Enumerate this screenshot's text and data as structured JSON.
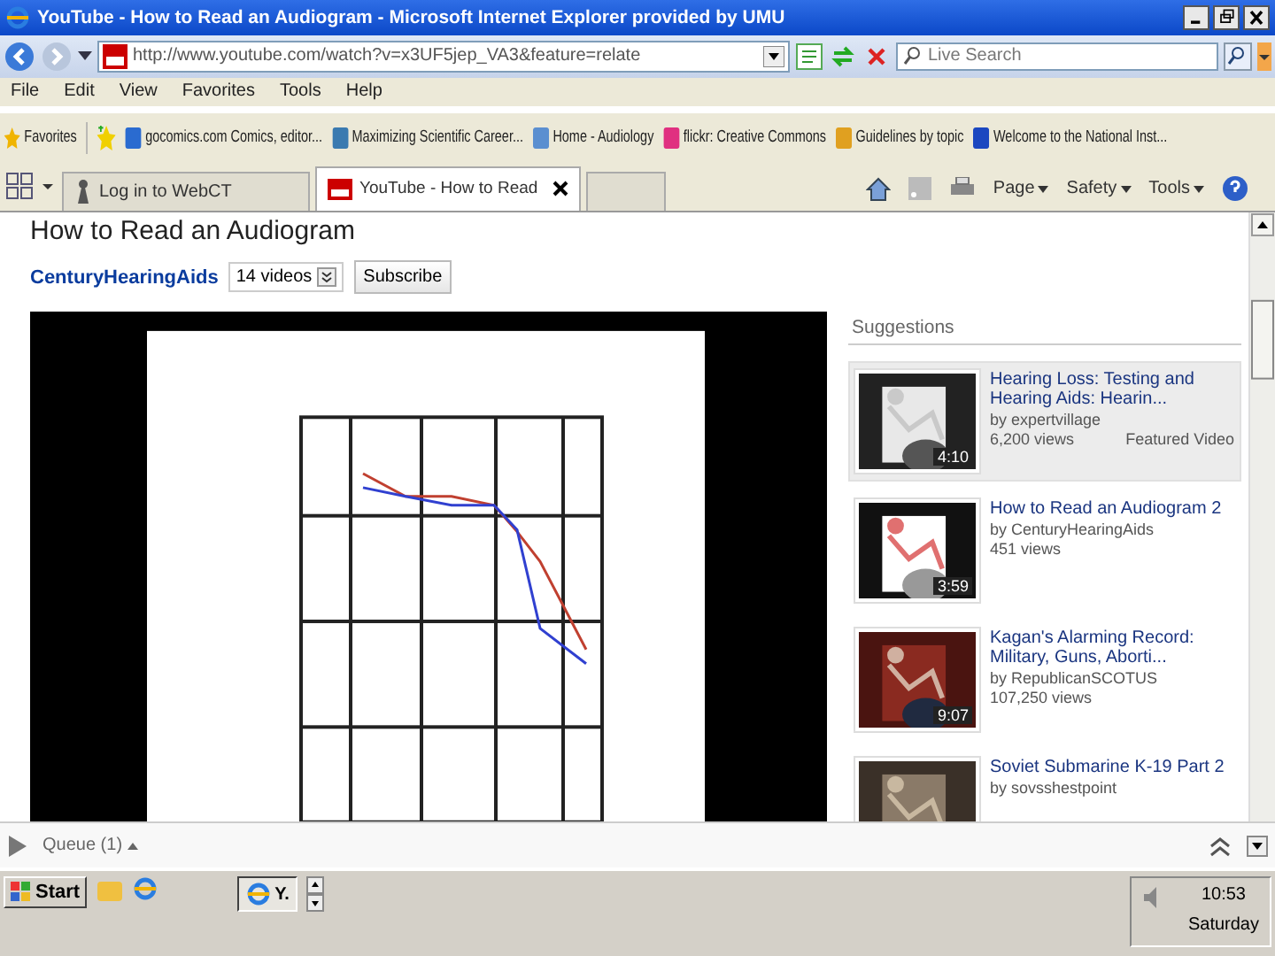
{
  "window": {
    "title": "YouTube - How to Read an Audiogram - Microsoft Internet Explorer provided by UMU"
  },
  "address_bar": {
    "url": "http://www.youtube.com/watch?v=x3UF5jep_VA3&feature=relate",
    "search_placeholder": "Live Search"
  },
  "menu": [
    "File",
    "Edit",
    "View",
    "Favorites",
    "Tools",
    "Help"
  ],
  "favorites_bar": {
    "label": "Favorites",
    "links": [
      "gocomics.com Comics, editor...",
      "Maximizing Scientific Career...",
      "Home - Audiology",
      "flickr: Creative Commons",
      "Guidelines by topic",
      "Welcome to the National Inst..."
    ]
  },
  "tabs": [
    {
      "label": "Log in to WebCT",
      "selected": false
    },
    {
      "label": "YouTube - How to Read",
      "selected": true
    }
  ],
  "command_bar": [
    "Page",
    "Safety",
    "Tools"
  ],
  "video": {
    "title": "How to Read an Audiogram",
    "channel": "CenturyHearingAids",
    "videos_count": "14 videos",
    "subscribe": "Subscribe"
  },
  "suggestions": {
    "heading": "Suggestions",
    "items": [
      {
        "title": "Hearing Loss: Testing and Hearing Aids: Hearin...",
        "author": "by expertvillage",
        "views": "6,200 views",
        "tag": "Featured Video",
        "duration": "4:10",
        "selected": true
      },
      {
        "title": "How to Read an Audiogram 2",
        "author": "by CenturyHearingAids",
        "views": "451 views",
        "duration": "3:59",
        "selected": false
      },
      {
        "title": "Kagan's Alarming Record: Military, Guns, Aborti...",
        "author": "by RepublicanSCOTUS",
        "views": "107,250 views",
        "duration": "9:07",
        "selected": false
      },
      {
        "title": "Soviet Submarine K-19 Part 2",
        "author": "by sovsshestpoint",
        "selected": false
      }
    ]
  },
  "queue": {
    "label": "Queue (1)"
  },
  "taskbar": {
    "start": "Start",
    "task": "Y.",
    "time": "10:53",
    "day": "Saturday"
  }
}
